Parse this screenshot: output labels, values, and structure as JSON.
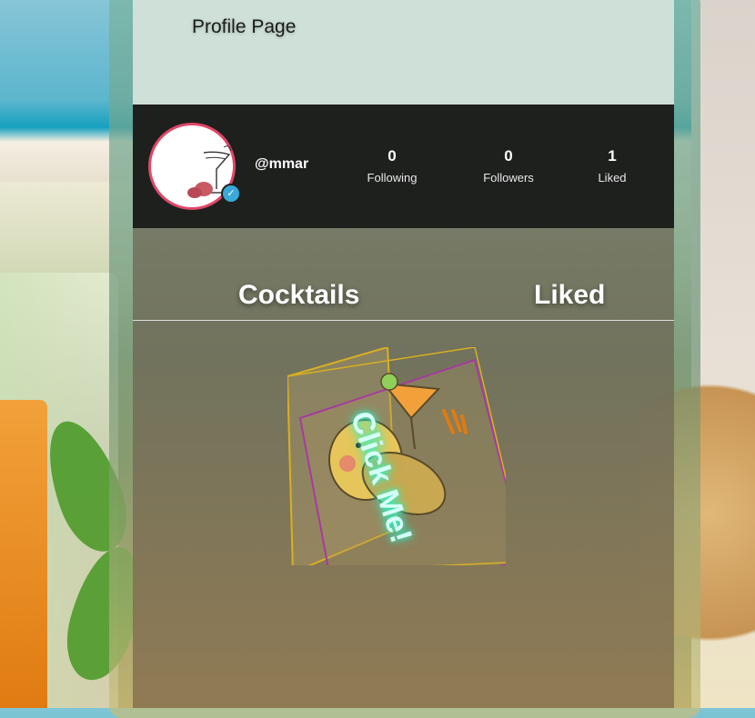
{
  "page": {
    "title": "Profile Page"
  },
  "profile": {
    "username": "@mmar",
    "stats": [
      {
        "value": "0",
        "label": "Following"
      },
      {
        "value": "0",
        "label": "Followers"
      },
      {
        "value": "1",
        "label": "Liked"
      }
    ]
  },
  "tabs": [
    {
      "label": "Cocktails"
    },
    {
      "label": "Liked"
    }
  ],
  "card": {
    "cta": "Click Me!"
  },
  "colors": {
    "avatar_border": "#e14767",
    "verified": "#39a9d9",
    "glow": "#2ff3c7"
  }
}
